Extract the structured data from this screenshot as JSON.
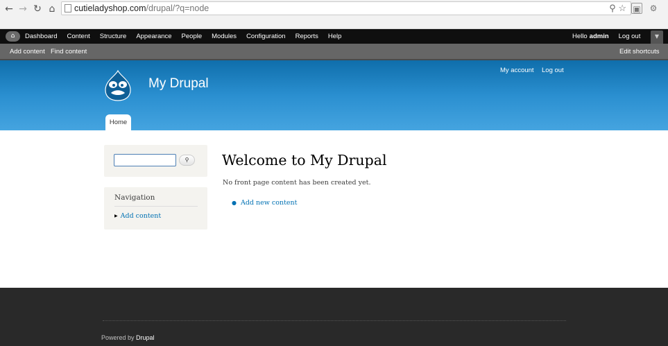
{
  "browser": {
    "url_host": "cutieladyshop.com",
    "url_path": "/drupal/?q=node"
  },
  "toolbar": {
    "menu": [
      "Dashboard",
      "Content",
      "Structure",
      "Appearance",
      "People",
      "Modules",
      "Configuration",
      "Reports",
      "Help"
    ],
    "hello_prefix": "Hello",
    "username": "admin",
    "logout": "Log out"
  },
  "shortcuts": {
    "items": [
      "Add content",
      "Find content"
    ],
    "edit": "Edit shortcuts"
  },
  "header": {
    "site_name": "My Drupal",
    "secondary": [
      "My account",
      "Log out"
    ],
    "tab_home": "Home"
  },
  "sidebar": {
    "nav_title": "Navigation",
    "nav_items": [
      "Add content"
    ]
  },
  "main": {
    "title": "Welcome to My Drupal",
    "message": "No front page content has been created yet.",
    "links": [
      "Add new content"
    ]
  },
  "footer": {
    "powered_prefix": "Powered by",
    "powered_name": "Drupal"
  },
  "colors": {
    "link": "#0071b3",
    "header_top": "#0f6eab",
    "header_bottom": "#45a4e0",
    "toolbar": "#0f0f0f",
    "footer": "#292929"
  }
}
